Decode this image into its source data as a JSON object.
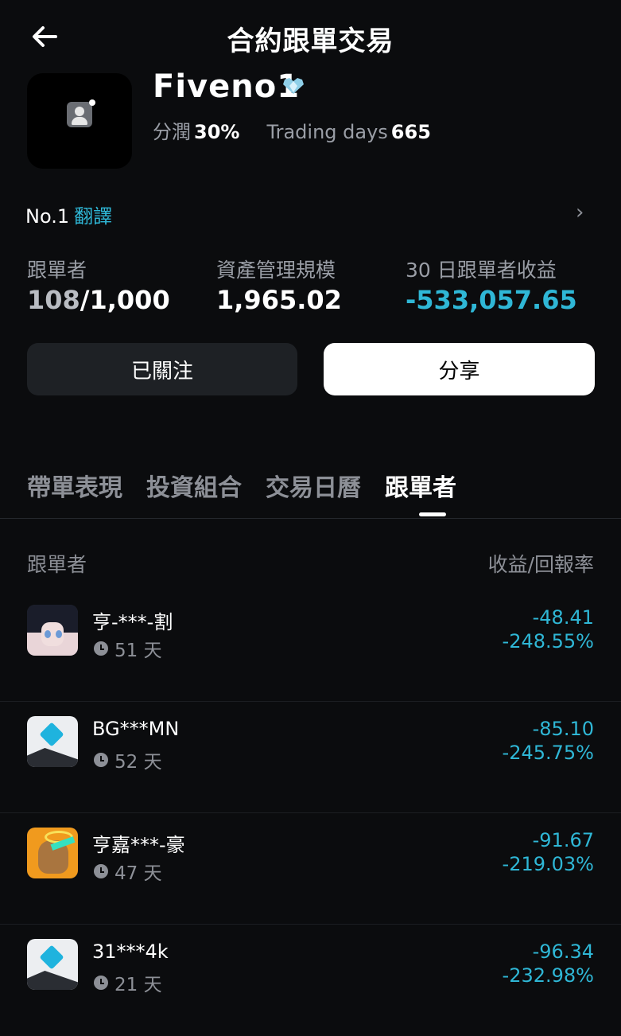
{
  "header": {
    "title": "合約跟單交易"
  },
  "profile": {
    "name": "Fiveno1",
    "profit_share_label": "分潤",
    "profit_share_value": "30%",
    "trading_days_label": "Trading days",
    "trading_days_value": "665",
    "rank_label": "No.1",
    "translate_link": "翻譯"
  },
  "stats": {
    "followers_label": "跟單者",
    "followers_current": "108",
    "followers_max": "/1,000",
    "aum_label": "資產管理規模",
    "aum_value": "1,965.02",
    "pnl_label": "30 日跟單者收益",
    "pnl_value": "-533,057.65"
  },
  "buttons": {
    "follow": "已關注",
    "share": "分享"
  },
  "tabs": [
    "帶單表現",
    "投資組合",
    "交易日曆",
    "跟單者"
  ],
  "active_tab": 3,
  "list": {
    "col_follower": "跟單者",
    "col_return": "收益/回報率",
    "rows": [
      {
        "name": "亨-***-割",
        "days": "51 天",
        "profit": "-48.41",
        "ratio": "-248.55%",
        "avatar": "anime"
      },
      {
        "name": "BG***MN",
        "days": "52 天",
        "profit": "-85.10",
        "ratio": "-245.75%",
        "avatar": "generic"
      },
      {
        "name": "亨嘉***-豪",
        "days": "47 天",
        "profit": "-91.67",
        "ratio": "-219.03%",
        "avatar": "ape"
      },
      {
        "name": "31***4k",
        "days": "21 天",
        "profit": "-96.34",
        "ratio": "-232.98%",
        "avatar": "generic"
      }
    ]
  },
  "colors": {
    "accent": "#2fb7d6",
    "background": "#0b0c0e"
  }
}
